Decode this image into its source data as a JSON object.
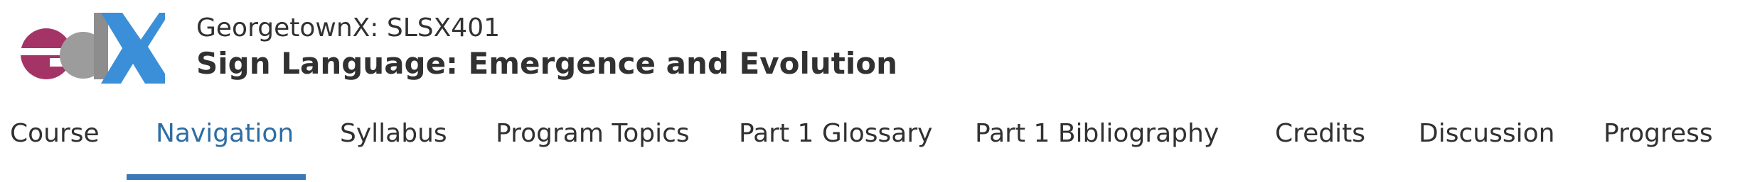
{
  "brand": {
    "logo_text": "edX",
    "logo_colors": {
      "e": "#a53466",
      "d": "#808080",
      "x": "#3a8fd8"
    }
  },
  "course": {
    "org_code": "GeorgetownX: SLSX401",
    "title": "Sign Language: Emergence and Evolution"
  },
  "tabs": [
    {
      "label": "Course",
      "active": false
    },
    {
      "label": "Navigation",
      "active": true
    },
    {
      "label": "Syllabus",
      "active": false
    },
    {
      "label": "Program Topics",
      "active": false
    },
    {
      "label": "Part 1 Glossary",
      "active": false
    },
    {
      "label": "Part 1 Bibliography",
      "active": false
    },
    {
      "label": "Credits",
      "active": false
    },
    {
      "label": "Discussion",
      "active": false
    },
    {
      "label": "Progress",
      "active": false
    }
  ],
  "colors": {
    "active_tab": "#2e6da4",
    "active_underline": "#3a78b7",
    "text": "#313131"
  }
}
